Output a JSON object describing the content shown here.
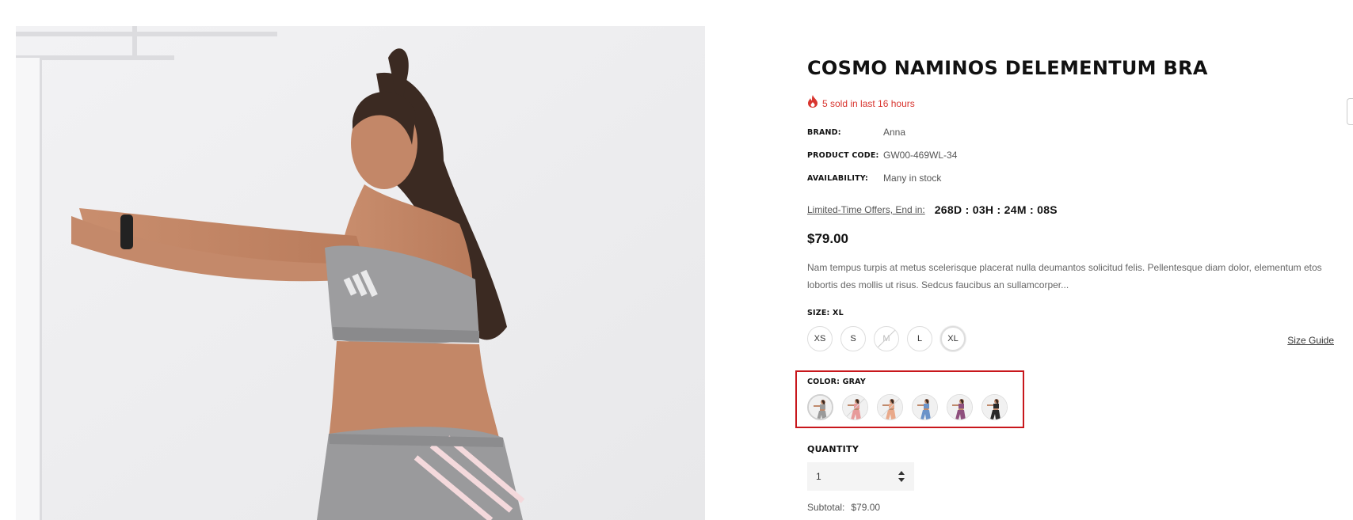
{
  "product": {
    "title": "COSMO NAMINOS DELEMENTUM BRA",
    "sold_text": "5 sold in last 16 hours",
    "brand_label": "BRAND:",
    "brand": "Anna",
    "code_label": "PRODUCT CODE:",
    "code": "GW00-469WL-34",
    "availability_label": "AVAILABILITY:",
    "availability": "Many in stock",
    "countdown_label": "Limited-Time Offers, End in:",
    "countdown_value": "268D : 03H : 24M : 08S",
    "price": "$79.00",
    "description": "Nam tempus turpis at metus scelerisque placerat nulla deumantos solicitud felis. Pellentesque diam dolor, elementum etos lobortis des mollis ut risus. Sedcus faucibus an sullamcorper..."
  },
  "size": {
    "label": "SIZE: XL",
    "guide_label": "Size Guide",
    "options": [
      {
        "label": "XS",
        "state": "available"
      },
      {
        "label": "S",
        "state": "available"
      },
      {
        "label": "M",
        "state": "disabled"
      },
      {
        "label": "L",
        "state": "available"
      },
      {
        "label": "XL",
        "state": "selected"
      }
    ]
  },
  "color": {
    "label": "COLOR: GRAY",
    "swatches": [
      {
        "name": "gray",
        "hex": "#9a9a9a",
        "state": "selected"
      },
      {
        "name": "pink",
        "hex": "#e79a9a",
        "state": "disabled"
      },
      {
        "name": "peach",
        "hex": "#e9a98a",
        "state": "disabled"
      },
      {
        "name": "blue",
        "hex": "#6b93c9",
        "state": "available"
      },
      {
        "name": "purple",
        "hex": "#8e4f7d",
        "state": "available"
      },
      {
        "name": "black",
        "hex": "#2a2a2a",
        "state": "available"
      }
    ],
    "highlight_color": "#c8171c"
  },
  "quantity": {
    "label": "QUANTITY",
    "value": "1"
  },
  "subtotal": {
    "label": "Subtotal:",
    "value": "$79.00"
  },
  "colors": {
    "accent_red": "#d8352f",
    "text_dark": "#111111"
  }
}
